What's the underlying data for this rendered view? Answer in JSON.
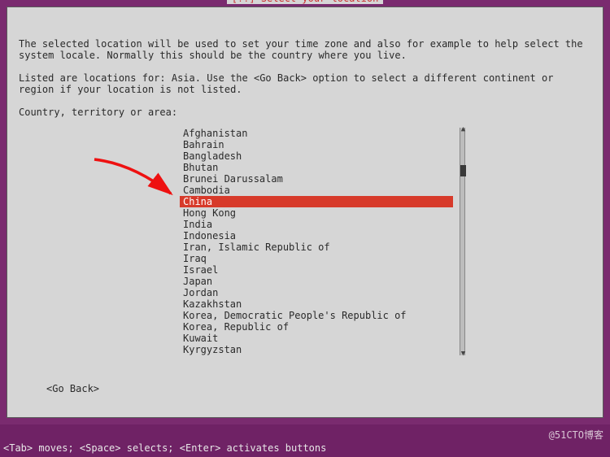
{
  "dialog": {
    "title_prefix": "[!!] ",
    "title": "Select your location",
    "paragraph1": "The selected location will be used to set your time zone and also for example to help select the system locale. Normally this should be the country where you live.",
    "paragraph2": "Listed are locations for: Asia. Use the <Go Back> option to select a different continent or region if your location is not listed.",
    "list_label": "Country, territory or area:",
    "go_back": "<Go Back>"
  },
  "countries": [
    "Afghanistan",
    "Bahrain",
    "Bangladesh",
    "Bhutan",
    "Brunei Darussalam",
    "Cambodia",
    "China",
    "Hong Kong",
    "India",
    "Indonesia",
    "Iran, Islamic Republic of",
    "Iraq",
    "Israel",
    "Japan",
    "Jordan",
    "Kazakhstan",
    "Korea, Democratic People's Republic of",
    "Korea, Republic of",
    "Kuwait",
    "Kyrgyzstan"
  ],
  "selected_index": 6,
  "bottom_bar": {
    "hint": "<Tab> moves; <Space> selects; <Enter> activates buttons"
  },
  "watermark": "@51CTO博客"
}
